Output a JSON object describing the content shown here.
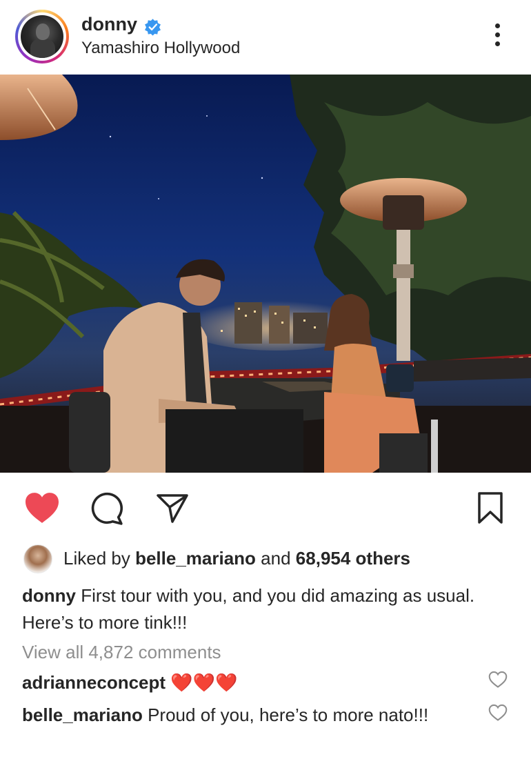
{
  "post": {
    "username": "donny",
    "location": "Yamashiro Hollywood",
    "verified": true
  },
  "actions": {
    "like_icon": "heart-filled-icon",
    "comment_icon": "comment-icon",
    "share_icon": "send-icon",
    "save_icon": "bookmark-icon",
    "like_color": "#ed4956"
  },
  "likes": {
    "prefix": "Liked by",
    "user": "belle_mariano",
    "middle": "and",
    "count": "68,954 others"
  },
  "caption": {
    "username": "donny",
    "text": "First tour with you, and you did amazing as usual. Here’s to more tink!!!"
  },
  "view_all": "View all 4,872 comments",
  "comments": [
    {
      "username": "adrianneconcept",
      "text": "❤️❤️❤️"
    },
    {
      "username": "belle_mariano",
      "text": "Proud of you, here’s to more nato!!!"
    }
  ]
}
